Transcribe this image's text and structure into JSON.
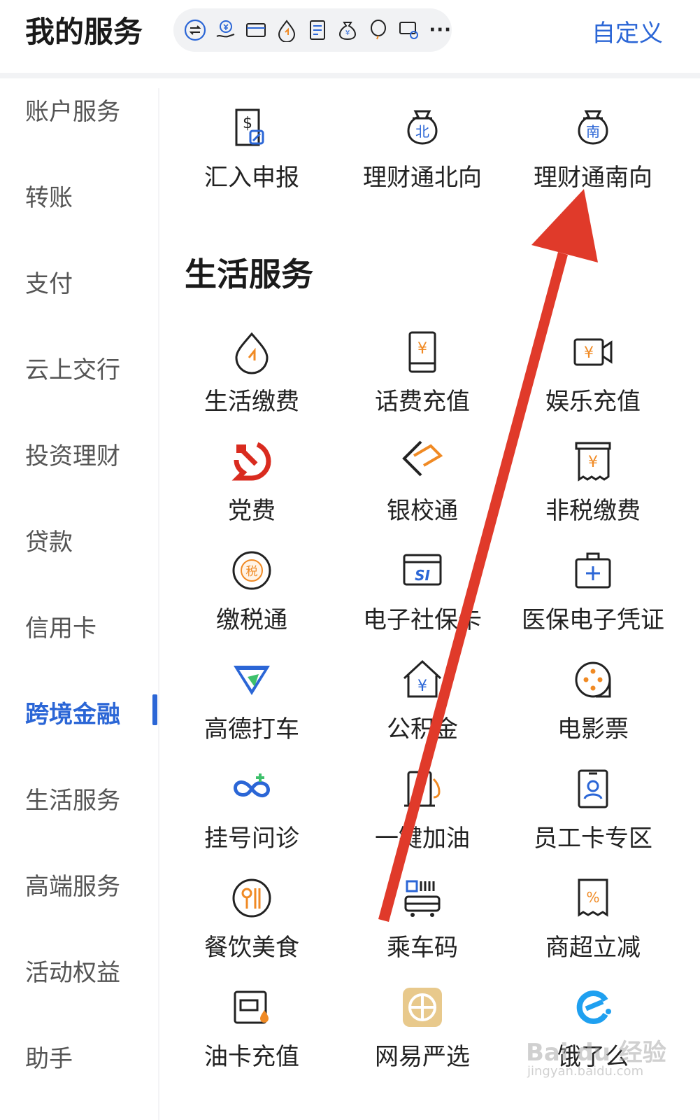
{
  "header": {
    "title": "我的服务",
    "customize_label": "自定义",
    "shortcut_icons": [
      "transfer-icon",
      "yuan-hand-icon",
      "card-icon",
      "drop-bill-icon",
      "document-icon",
      "money-bag-icon",
      "balloon-icon",
      "card-link-icon"
    ],
    "more_label": "···"
  },
  "sidebar": {
    "items": [
      {
        "label": "账户服务",
        "active": false
      },
      {
        "label": "转账",
        "active": false
      },
      {
        "label": "支付",
        "active": false
      },
      {
        "label": "云上交行",
        "active": false
      },
      {
        "label": "投资理财",
        "active": false
      },
      {
        "label": "贷款",
        "active": false
      },
      {
        "label": "信用卡",
        "active": false
      },
      {
        "label": "跨境金融",
        "active": true
      },
      {
        "label": "生活服务",
        "active": false
      },
      {
        "label": "高端服务",
        "active": false
      },
      {
        "label": "活动权益",
        "active": false
      },
      {
        "label": "助手",
        "active": false
      }
    ]
  },
  "cross_border": {
    "items": [
      {
        "label": "汇入申报",
        "icon": "remittance-report-icon"
      },
      {
        "label": "理财通北向",
        "icon": "wealth-northbound-icon"
      },
      {
        "label": "理财通南向",
        "icon": "wealth-southbound-icon"
      }
    ]
  },
  "life_services": {
    "title": "生活服务",
    "items": [
      {
        "label": "生活缴费",
        "icon": "utility-drop-icon"
      },
      {
        "label": "话费充值",
        "icon": "phone-topup-icon"
      },
      {
        "label": "娱乐充值",
        "icon": "entertainment-topup-icon"
      },
      {
        "label": "党费",
        "icon": "party-emblem-icon"
      },
      {
        "label": "银校通",
        "icon": "bank-school-icon"
      },
      {
        "label": "非税缴费",
        "icon": "non-tax-receipt-icon"
      },
      {
        "label": "缴税通",
        "icon": "tax-icon"
      },
      {
        "label": "电子社保卡",
        "icon": "social-security-card-icon"
      },
      {
        "label": "医保电子凭证",
        "icon": "medical-insurance-icon"
      },
      {
        "label": "高德打车",
        "icon": "amap-taxi-icon"
      },
      {
        "label": "公积金",
        "icon": "housing-fund-icon"
      },
      {
        "label": "电影票",
        "icon": "movie-ticket-icon"
      },
      {
        "label": "挂号问诊",
        "icon": "hospital-registration-icon"
      },
      {
        "label": "一键加油",
        "icon": "fuel-icon"
      },
      {
        "label": "员工卡专区",
        "icon": "employee-card-icon"
      },
      {
        "label": "餐饮美食",
        "icon": "dining-icon"
      },
      {
        "label": "乘车码",
        "icon": "bus-qr-icon"
      },
      {
        "label": "商超立减",
        "icon": "supermarket-discount-icon"
      },
      {
        "label": "油卡充值",
        "icon": "fuel-card-icon"
      },
      {
        "label": "网易严选",
        "icon": "netease-yanxuan-icon"
      },
      {
        "label": "饿了么",
        "icon": "eleme-icon"
      }
    ]
  },
  "colors": {
    "accent": "#2b66d6",
    "icon_orange": "#f08a24",
    "annotation_arrow": "#e03a2a"
  },
  "watermark": {
    "text": "Bai du 经验",
    "sub": "jingyan.baidu.com"
  }
}
